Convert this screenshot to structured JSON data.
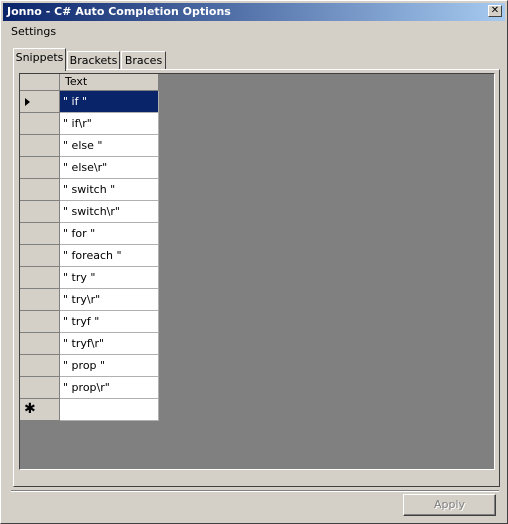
{
  "window": {
    "title": "Jonno - C# Auto Completion Options",
    "close_glyph": "✕"
  },
  "menubar": {
    "items": [
      {
        "label": "Settings"
      }
    ]
  },
  "tabs": [
    {
      "label": "Snippets",
      "active": true
    },
    {
      "label": "Brackets",
      "active": false
    },
    {
      "label": "Braces",
      "active": false
    }
  ],
  "grid": {
    "column_header": "Text",
    "rows": [
      {
        "text": "\" if \"",
        "selected": true
      },
      {
        "text": "\" if\\r\""
      },
      {
        "text": "\" else \""
      },
      {
        "text": "\" else\\r\""
      },
      {
        "text": "\" switch \""
      },
      {
        "text": "\" switch\\r\""
      },
      {
        "text": "\" for \""
      },
      {
        "text": "\" foreach \""
      },
      {
        "text": "\" try \""
      },
      {
        "text": "\" try\\r\""
      },
      {
        "text": "\" tryf \""
      },
      {
        "text": "\" tryf\\r\""
      },
      {
        "text": "\" prop \""
      },
      {
        "text": "\" prop\\r\""
      }
    ],
    "new_row_glyph": "✱"
  },
  "footer": {
    "apply_label": "Apply",
    "apply_enabled": false
  }
}
